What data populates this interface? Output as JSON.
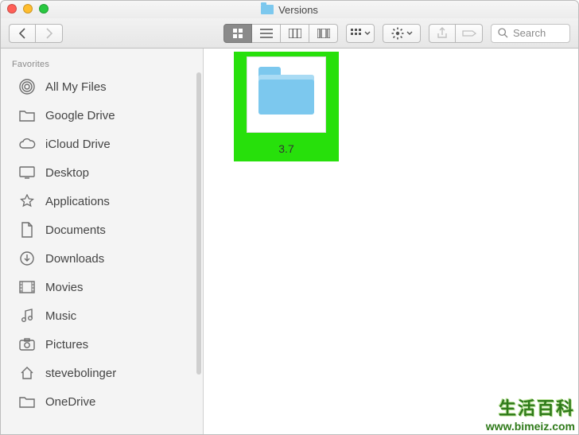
{
  "window": {
    "title": "Versions"
  },
  "toolbar": {
    "search_placeholder": "Search"
  },
  "sidebar": {
    "section_label": "Favorites",
    "items": [
      {
        "label": "All My Files",
        "icon": "airdrop-icon"
      },
      {
        "label": "Google Drive",
        "icon": "folder-icon"
      },
      {
        "label": "iCloud Drive",
        "icon": "cloud-icon"
      },
      {
        "label": "Desktop",
        "icon": "desktop-icon"
      },
      {
        "label": "Applications",
        "icon": "apps-icon"
      },
      {
        "label": "Documents",
        "icon": "documents-icon"
      },
      {
        "label": "Downloads",
        "icon": "downloads-icon"
      },
      {
        "label": "Movies",
        "icon": "movies-icon"
      },
      {
        "label": "Music",
        "icon": "music-icon"
      },
      {
        "label": "Pictures",
        "icon": "pictures-icon"
      },
      {
        "label": "stevebolinger",
        "icon": "home-icon"
      },
      {
        "label": "OneDrive",
        "icon": "folder-icon"
      }
    ]
  },
  "content": {
    "items": [
      {
        "name": "3.7",
        "kind": "folder",
        "highlighted": true
      }
    ]
  },
  "watermark": {
    "line1": "生活百科",
    "line2": "www.bimeiz.com"
  }
}
